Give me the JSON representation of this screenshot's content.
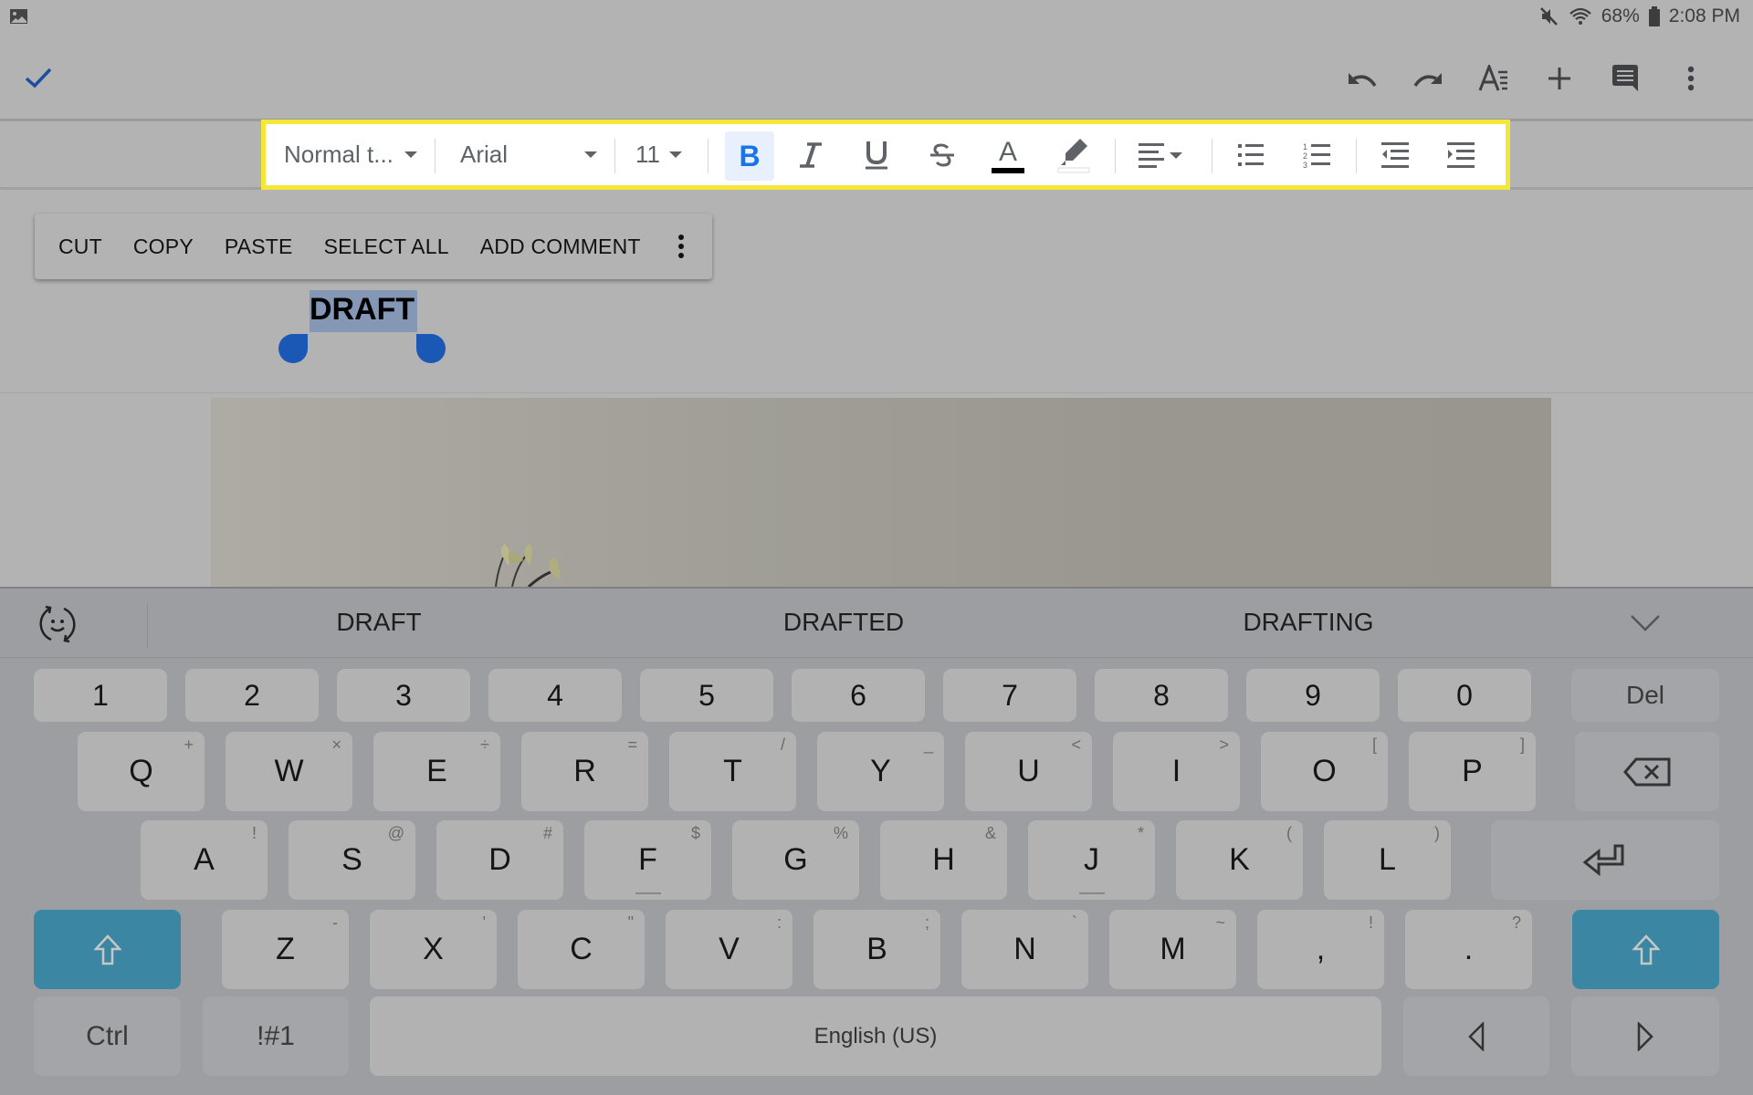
{
  "status_bar": {
    "left_icon": "gallery-icon",
    "icons": [
      "mute-icon",
      "wifi-icon",
      "battery-icon"
    ],
    "battery": "68%",
    "time": "2:08 PM"
  },
  "app_bar": {
    "done_icon": "check-icon",
    "actions": [
      {
        "name": "undo-button",
        "icon": "undo-icon"
      },
      {
        "name": "redo-button",
        "icon": "redo-icon"
      },
      {
        "name": "text-format-button",
        "icon": "text-format-icon"
      },
      {
        "name": "insert-button",
        "icon": "plus-icon"
      },
      {
        "name": "comment-button",
        "icon": "comment-icon"
      },
      {
        "name": "more-options-button",
        "icon": "more-vert-icon"
      }
    ]
  },
  "format_toolbar": {
    "highlight_color": "#f5e73a",
    "style_select": "Normal t...",
    "font_select": "Arial",
    "size_select": "11",
    "bold_label": "B",
    "bold_active": true,
    "active_color": "#1a73e8",
    "text_color_label": "A",
    "text_color": "#000000",
    "buttons": [
      "bold",
      "italic",
      "underline",
      "strikethrough",
      "text-color",
      "highlight",
      "align",
      "bulleted-list",
      "numbered-list",
      "decrease-indent",
      "increase-indent"
    ]
  },
  "context_menu": {
    "items": [
      "CUT",
      "COPY",
      "PASTE",
      "SELECT ALL",
      "ADD COMMENT"
    ],
    "more_icon": "more-vert-icon"
  },
  "document": {
    "selected_text": "DRAFT",
    "selection_color": "#8497b5",
    "handle_color": "#1b57b5"
  },
  "keyboard": {
    "suggestions": [
      "DRAFT",
      "DRAFTED",
      "DRAFTING"
    ],
    "number_row": [
      "1",
      "2",
      "3",
      "4",
      "5",
      "6",
      "7",
      "8",
      "9",
      "0"
    ],
    "del_label": "Del",
    "row_q": [
      {
        "k": "Q",
        "s": "+"
      },
      {
        "k": "W",
        "s": "×"
      },
      {
        "k": "E",
        "s": "÷"
      },
      {
        "k": "R",
        "s": "="
      },
      {
        "k": "T",
        "s": "/"
      },
      {
        "k": "Y",
        "s": "_"
      },
      {
        "k": "U",
        "s": "<"
      },
      {
        "k": "I",
        "s": ">"
      },
      {
        "k": "O",
        "s": "["
      },
      {
        "k": "P",
        "s": "]"
      }
    ],
    "row_a": [
      {
        "k": "A",
        "s": "!"
      },
      {
        "k": "S",
        "s": "@"
      },
      {
        "k": "D",
        "s": "#"
      },
      {
        "k": "F",
        "s": "$"
      },
      {
        "k": "G",
        "s": "%"
      },
      {
        "k": "H",
        "s": "&"
      },
      {
        "k": "J",
        "s": "*"
      },
      {
        "k": "K",
        "s": "("
      },
      {
        "k": "L",
        "s": ")"
      }
    ],
    "row_z": [
      {
        "k": "Z",
        "s": "-"
      },
      {
        "k": "X",
        "s": "'"
      },
      {
        "k": "C",
        "s": "\""
      },
      {
        "k": "V",
        "s": ":"
      },
      {
        "k": "B",
        "s": ";"
      },
      {
        "k": "N",
        "s": "`"
      },
      {
        "k": "M",
        "s": "~"
      },
      {
        "k": ",",
        "s": "!"
      },
      {
        "k": ".",
        "s": "?"
      }
    ],
    "ctrl_label": "Ctrl",
    "symbols_label": "!#1",
    "space_label": "English (US)",
    "shift_color": "#3b87a3"
  }
}
